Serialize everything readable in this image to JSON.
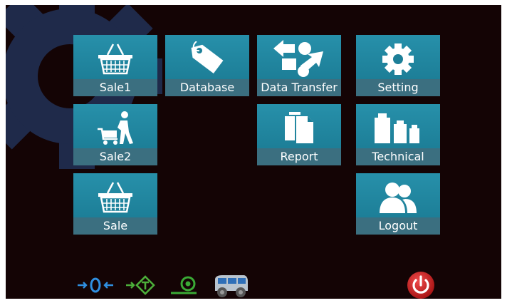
{
  "tiles": [
    {
      "label": "Sale1",
      "icon": "shopping-basket-icon"
    },
    {
      "label": "Database",
      "icon": "price-tag-icon"
    },
    {
      "label": "Data Transfer",
      "icon": "data-transfer-icon"
    },
    {
      "label": "Setting",
      "icon": "gear-icon"
    },
    {
      "label": "Sale2",
      "icon": "shopping-cart-person-icon"
    },
    {
      "label": "Report",
      "icon": "documents-icon"
    },
    {
      "label": "Technical",
      "icon": "weights-icon"
    },
    {
      "label": "Sale",
      "icon": "shopping-basket-icon"
    },
    {
      "label": "Logout",
      "icon": "users-icon"
    }
  ],
  "bottom_bar": {
    "zero": "zero-icon",
    "tare": "tare-icon",
    "stable": "stable-icon",
    "truck": "vehicle-icon",
    "power": "power-icon"
  },
  "colors": {
    "background": "#140405",
    "tile": "#1d7f98",
    "tile_label_bar": "#3b6f80",
    "background_gear": "#1f2a4a",
    "zero_icon": "#2f8fe0",
    "tare_icon": "#4caf3a",
    "stable_icon": "#3aaa35",
    "power": "#c81e1e"
  }
}
